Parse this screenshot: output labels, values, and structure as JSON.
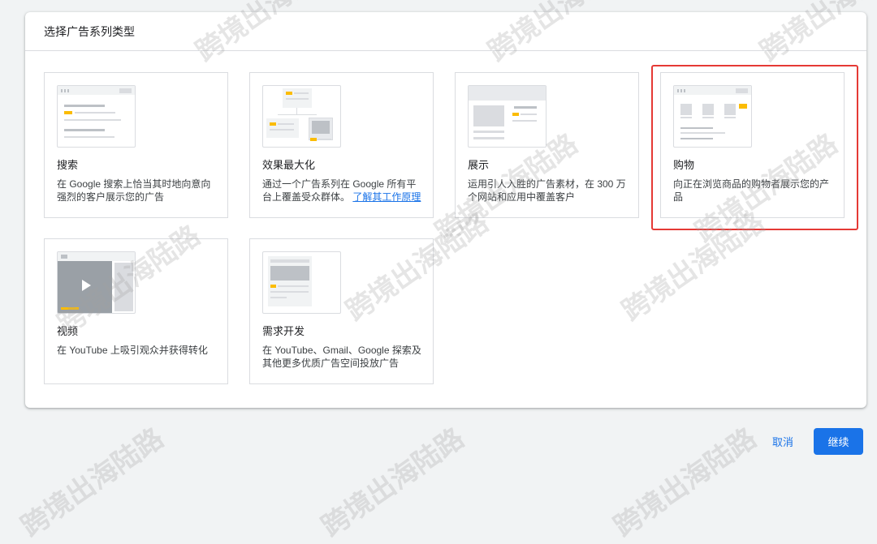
{
  "dialog": {
    "title": "选择广告系列类型"
  },
  "cards": [
    {
      "name": "搜索",
      "desc": "在 Google 搜索上恰当其时地向意向强烈的客户展示您的广告",
      "thumb": "search-thumbnail"
    },
    {
      "name": "效果最大化",
      "desc": "通过一个广告系列在 Google 所有平台上覆盖受众群体。",
      "link": "了解其工作原理",
      "thumb": "performance-max-thumbnail"
    },
    {
      "name": "展示",
      "desc": "运用引人入胜的广告素材，在 300 万个网站和应用中覆盖客户",
      "thumb": "display-thumbnail"
    },
    {
      "name": "购物",
      "desc": "向正在浏览商品的购物者展示您的产品",
      "thumb": "shopping-thumbnail",
      "highlighted": true
    },
    {
      "name": "视频",
      "desc": "在 YouTube 上吸引观众并获得转化",
      "thumb": "video-thumbnail"
    },
    {
      "name": "需求开发",
      "desc": "在 YouTube、Gmail、Google 探索及其他更多优质广告空间投放广告",
      "thumb": "demand-gen-thumbnail"
    }
  ],
  "actions": {
    "cancel_label": "取消",
    "continue_label": "继续"
  },
  "watermark": "跨境出海陆路",
  "colors": {
    "accent": "#1a73e8",
    "highlight": "#e53935",
    "thumb_yellow": "#fbbc04"
  }
}
